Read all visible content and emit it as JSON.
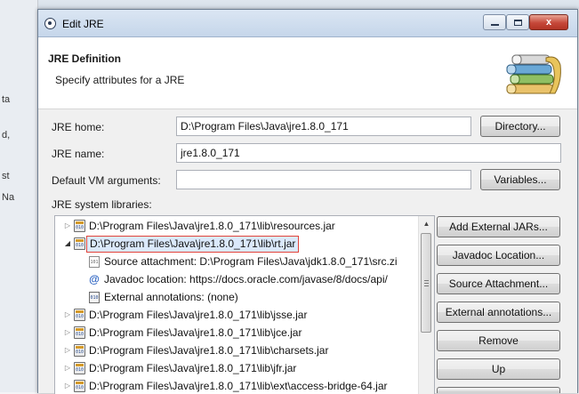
{
  "window": {
    "title": "Edit JRE",
    "close_glyph": "x"
  },
  "header": {
    "title": "JRE Definition",
    "description": "Specify attributes for a JRE"
  },
  "form": {
    "jre_home_label": "JRE home:",
    "jre_home_value": "D:\\Program Files\\Java\\jre1.8.0_171",
    "directory_button": "Directory...",
    "jre_name_label": "JRE name:",
    "jre_name_value": "jre1.8.0_171",
    "vm_args_label": "Default VM arguments:",
    "vm_args_value": "",
    "variables_button": "Variables...",
    "libraries_label": "JRE system libraries:"
  },
  "libraries": [
    {
      "label": "D:\\Program Files\\Java\\jre1.8.0_171\\lib\\resources.jar"
    },
    {
      "label": "D:\\Program Files\\Java\\jre1.8.0_171\\lib\\rt.jar"
    },
    {
      "label": "Source attachment: D:\\Program Files\\Java\\jdk1.8.0_171\\src.zi"
    },
    {
      "label": "Javadoc location: https://docs.oracle.com/javase/8/docs/api/"
    },
    {
      "label": "External annotations: (none)"
    },
    {
      "label": "D:\\Program Files\\Java\\jre1.8.0_171\\lib\\jsse.jar"
    },
    {
      "label": "D:\\Program Files\\Java\\jre1.8.0_171\\lib\\jce.jar"
    },
    {
      "label": "D:\\Program Files\\Java\\jre1.8.0_171\\lib\\charsets.jar"
    },
    {
      "label": "D:\\Program Files\\Java\\jre1.8.0_171\\lib\\jfr.jar"
    },
    {
      "label": "D:\\Program Files\\Java\\jre1.8.0_171\\lib\\ext\\access-bridge-64.jar"
    }
  ],
  "side_buttons": {
    "add_external_jars": "Add External JARs...",
    "javadoc_location": "Javadoc Location...",
    "source_attachment": "Source Attachment...",
    "external_annotations": "External annotations...",
    "remove": "Remove",
    "up": "Up"
  },
  "background": {
    "fragments": [
      "ta",
      "d,",
      "st",
      "Na"
    ]
  },
  "colors": {
    "selection_border": "#e2433a",
    "selection_fill": "#dbe9fb",
    "close_button": "#c6483a"
  }
}
